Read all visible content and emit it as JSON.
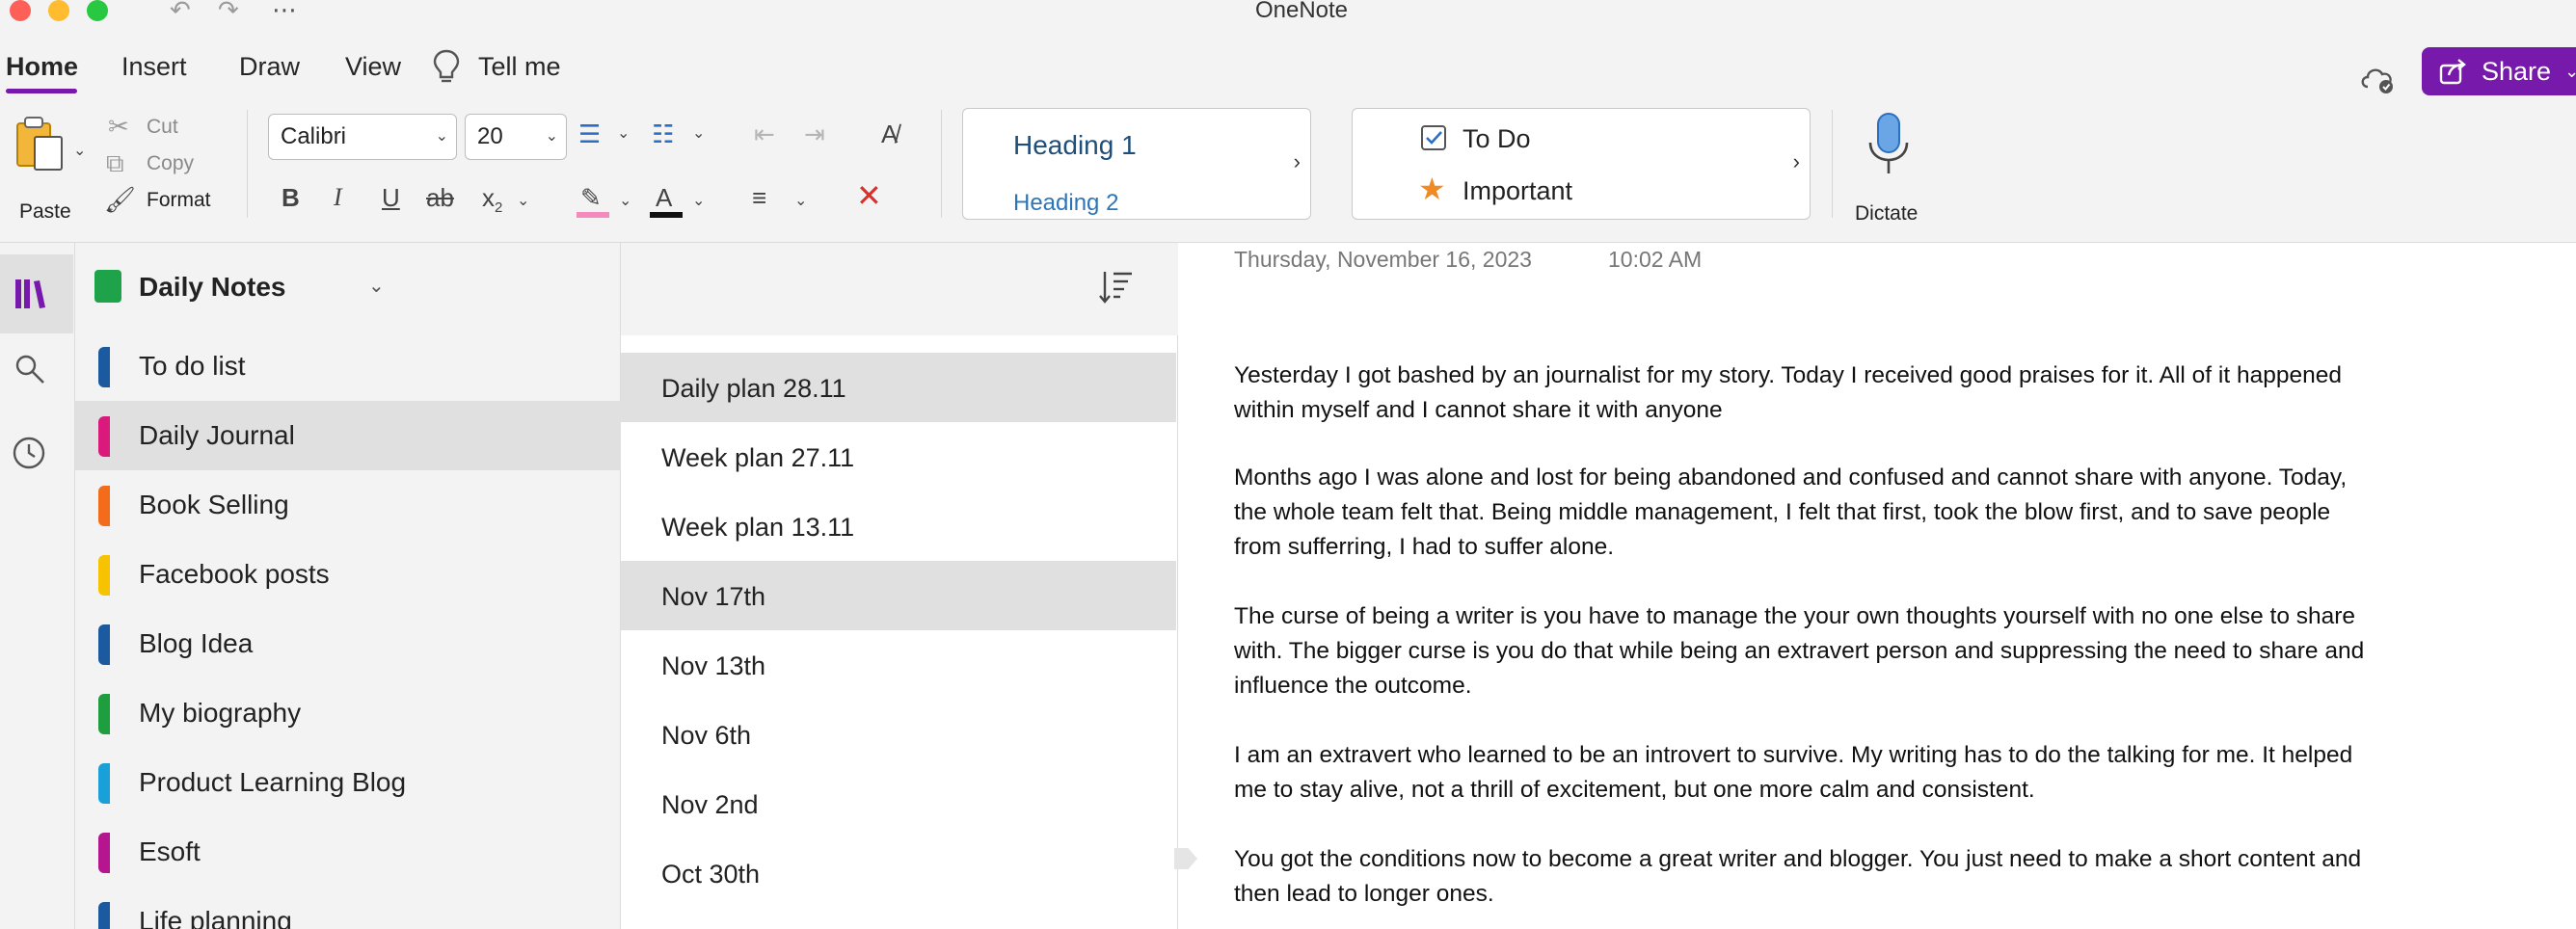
{
  "app": {
    "title": "OneNote"
  },
  "ribbon": {
    "tabs": [
      {
        "label": "Home",
        "active": true
      },
      {
        "label": "Insert"
      },
      {
        "label": "Draw"
      },
      {
        "label": "View"
      },
      {
        "label": "Tell me"
      }
    ],
    "share_label": "Share",
    "clipboard": {
      "paste": "Paste",
      "cut": "Cut",
      "copy": "Copy",
      "format": "Format"
    },
    "font": {
      "family": "Calibri",
      "size": "20"
    },
    "styles": {
      "heading1": "Heading 1",
      "heading2": "Heading 2"
    },
    "tags": {
      "todo": "To Do",
      "important": "Important"
    },
    "dictate": "Dictate",
    "accent_color": "#7719aa"
  },
  "notebook": {
    "name": "Daily Notes",
    "sections": [
      {
        "label": "To do list",
        "color": "#1b5a9e"
      },
      {
        "label": "Daily Journal",
        "color": "#d9197b",
        "selected": true
      },
      {
        "label": "Book Selling",
        "color": "#f36c1b"
      },
      {
        "label": "Facebook posts",
        "color": "#f7c300"
      },
      {
        "label": "Blog Idea",
        "color": "#1b5a9e"
      },
      {
        "label": "My biography",
        "color": "#1f9e3f"
      },
      {
        "label": "Product Learning Blog",
        "color": "#1aa0d8"
      },
      {
        "label": "Esoft",
        "color": "#b5168f"
      },
      {
        "label": "Life planning",
        "color": "#1b5a9e"
      }
    ]
  },
  "pages": [
    {
      "label": "Daily plan 28.11",
      "selected": true
    },
    {
      "label": "Week plan 27.11"
    },
    {
      "label": "Week plan 13.11"
    },
    {
      "label": "Nov 17th",
      "selected": true
    },
    {
      "label": "Nov 13th"
    },
    {
      "label": "Nov 6th"
    },
    {
      "label": "Nov 2nd"
    },
    {
      "label": "Oct 30th"
    }
  ],
  "note": {
    "date": "Thursday, November 16, 2023",
    "time": "10:02 AM",
    "paragraphs": [
      "Yesterday I got bashed by an journalist for my story. Today I received good praises for it. All of it happened within myself and I cannot share it with anyone",
      "Months ago I was alone and lost for being abandoned and confused and cannot share with anyone. Today, the whole team felt that. Being middle management, I felt that first, took the blow first, and to save people from sufferring, I had to suffer alone.",
      "The curse of being a writer is you have to manage the your own thoughts yourself with no one else to share with. The bigger curse is you do that while being an extravert person and suppressing the need to share and influence the outcome.",
      "I am an extravert who learned to be an introvert to survive. My writing has to do the talking for me.  It helped me to stay alive, not a thrill of excitement, but one more calm and consistent.",
      "You got the conditions now to become a great writer and blogger. You just need to make a short content and then lead to longer ones."
    ]
  }
}
